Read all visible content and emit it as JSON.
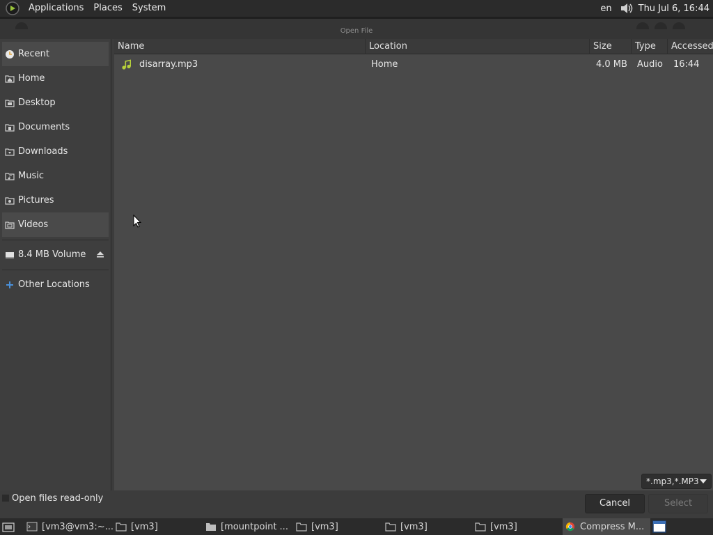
{
  "top_panel": {
    "menus": [
      "Applications",
      "Places",
      "System"
    ],
    "language": "en",
    "clock": "Thu Jul  6, 16:44"
  },
  "dialog": {
    "title": "Open File",
    "places": [
      {
        "label": "Recent",
        "icon": "recent-icon",
        "selected": true
      },
      {
        "label": "Home",
        "icon": "folder-home-icon"
      },
      {
        "label": "Desktop",
        "icon": "folder-desktop-icon"
      },
      {
        "label": "Documents",
        "icon": "folder-documents-icon"
      },
      {
        "label": "Downloads",
        "icon": "folder-downloads-icon"
      },
      {
        "label": "Music",
        "icon": "folder-music-icon"
      },
      {
        "label": "Pictures",
        "icon": "folder-pictures-icon"
      },
      {
        "label": "Videos",
        "icon": "folder-videos-icon"
      }
    ],
    "volume": {
      "label": "8.4 MB Volume",
      "icon": "drive-icon"
    },
    "other_locations": {
      "label": "Other Locations",
      "icon": "plus-icon"
    },
    "columns": {
      "name": "Name",
      "location": "Location",
      "size": "Size",
      "type": "Type",
      "accessed": "Accessed"
    },
    "files": [
      {
        "name": "disarray.mp3",
        "location": "Home",
        "size": "4.0 MB",
        "type": "Audio",
        "accessed": "16:44",
        "icon": "audio-file-icon"
      }
    ],
    "readonly_label": "Open files read-only",
    "filter": "*.mp3,*.MP3",
    "cancel_label": "Cancel",
    "select_label": "Select"
  },
  "taskbar": {
    "items": [
      {
        "label": "[vm3@vm3:~...",
        "icon": "terminal-icon"
      },
      {
        "label": "[vm3]",
        "icon": "folder-icon"
      },
      {
        "label": "[mountpoint ...",
        "icon": "folder-icon"
      },
      {
        "label": "[vm3]",
        "icon": "folder-icon"
      },
      {
        "label": "[vm3]",
        "icon": "folder-icon"
      },
      {
        "label": "[vm3]",
        "icon": "folder-icon"
      },
      {
        "label": "Compress M...",
        "icon": "chrome-icon"
      }
    ]
  },
  "colors": {
    "accent_music": "#b6d03b",
    "accent_plus": "#4a90d9"
  }
}
